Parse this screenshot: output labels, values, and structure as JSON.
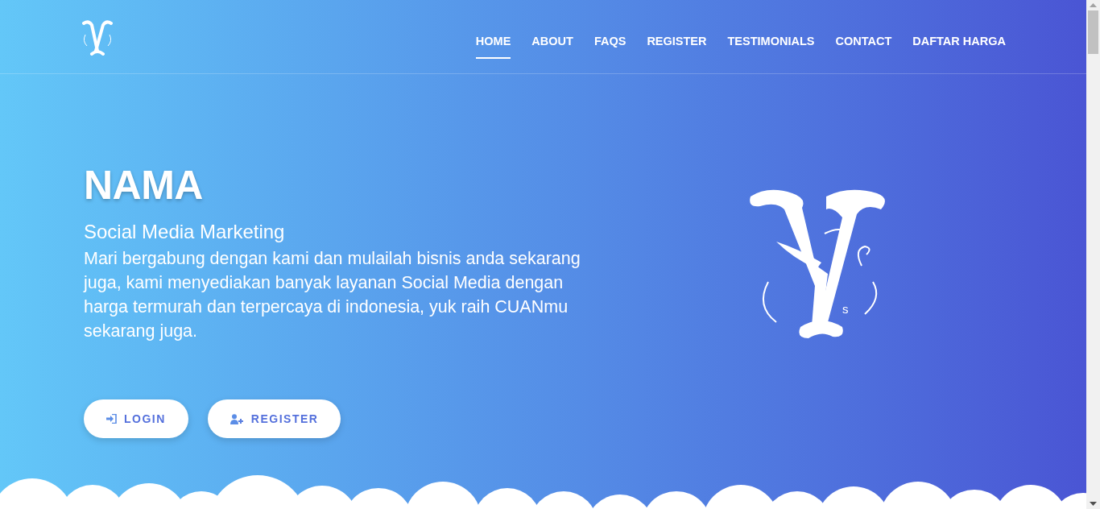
{
  "nav": {
    "items": [
      {
        "label": "HOME",
        "selected": true
      },
      {
        "label": "ABOUT",
        "selected": false
      },
      {
        "label": "FAQS",
        "selected": false
      },
      {
        "label": "REGISTER",
        "selected": false
      },
      {
        "label": "TESTIMONIALS",
        "selected": false
      },
      {
        "label": "CONTACT",
        "selected": false
      },
      {
        "label": "DAFTAR HARGA",
        "selected": false
      }
    ]
  },
  "hero": {
    "title": "NAMA",
    "subtitle": "Social Media Marketing",
    "description": "Mari bergabung dengan kami dan mulailah bisnis anda sekarang juga, kami menyediakan banyak layanan Social Media dengan harga termurah dan terpercaya di indonesia, yuk raih CUANmu sekarang juga.",
    "buttons": [
      {
        "kind": "login",
        "label": "LOGIN"
      },
      {
        "kind": "register",
        "label": "REGISTER"
      }
    ],
    "logo_mark": "s"
  }
}
